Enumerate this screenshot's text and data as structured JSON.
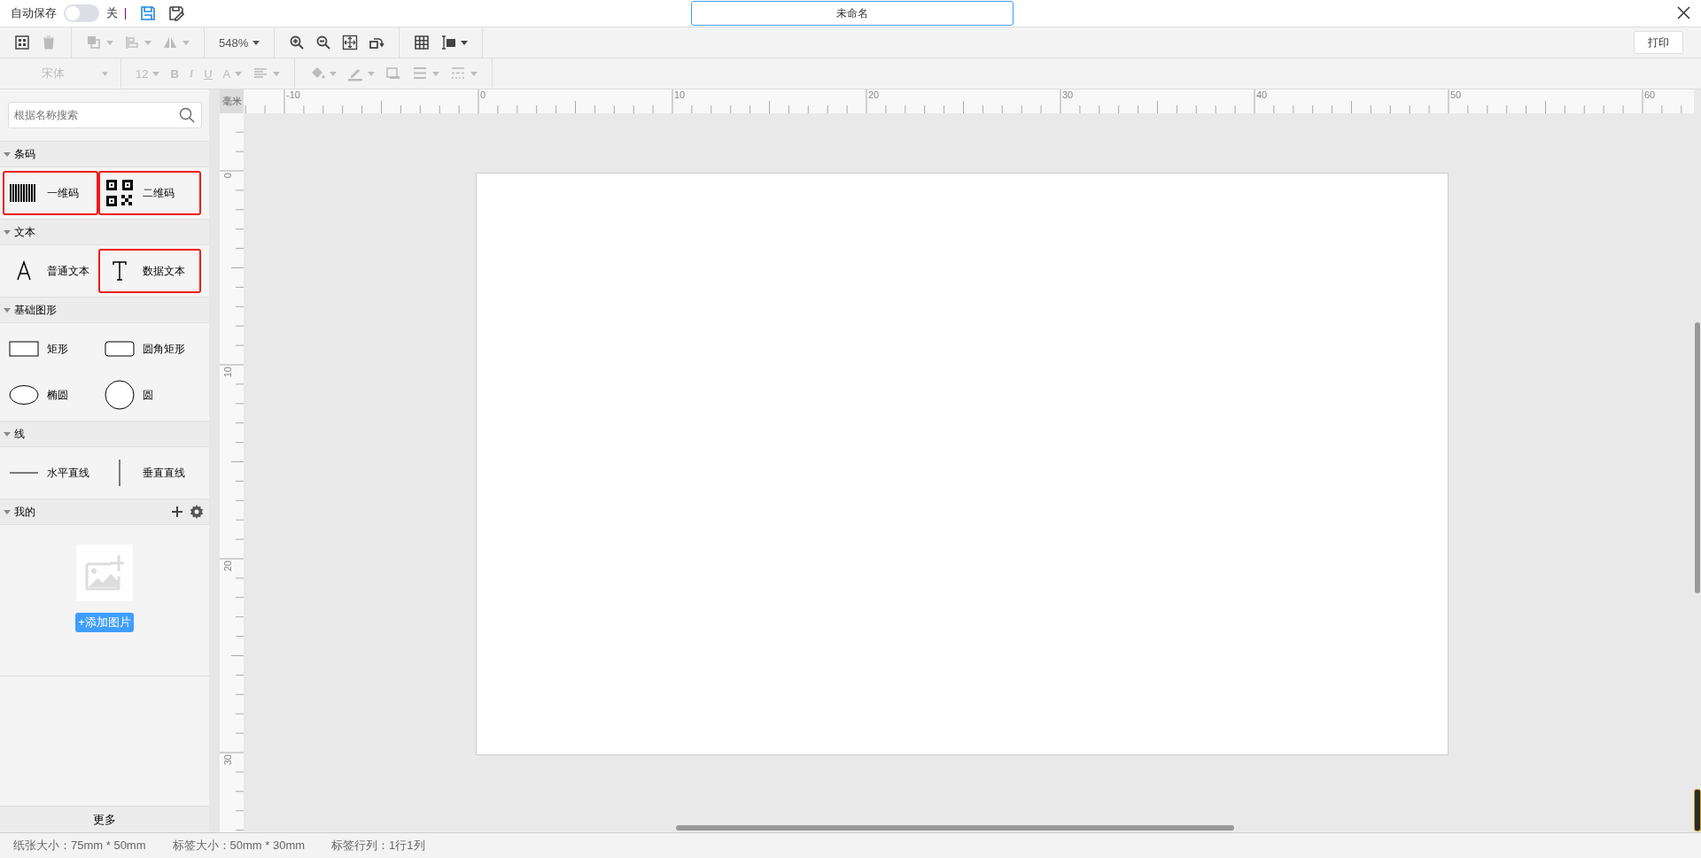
{
  "top_bar": {
    "autosave_label": "自动保存",
    "autosave_on": false,
    "autosave_state": "关",
    "document_title": "未命名"
  },
  "toolbar_rows": [
    [
      [
        {
          "kind": "select-all",
          "disabled": false,
          "dropdown": false
        },
        {
          "kind": "delete",
          "disabled": true,
          "dropdown": false
        }
      ],
      [
        {
          "kind": "layer",
          "disabled": true,
          "dropdown": true
        },
        {
          "kind": "align",
          "disabled": true,
          "dropdown": true
        },
        {
          "kind": "flip",
          "disabled": true,
          "dropdown": true
        }
      ],
      [
        {
          "kind": "zoom-level",
          "disabled": false,
          "dropdown": true,
          "label": "548%"
        }
      ],
      [
        {
          "kind": "zoom-in",
          "disabled": false,
          "dropdown": false
        },
        {
          "kind": "zoom-out",
          "disabled": false,
          "dropdown": false
        },
        {
          "kind": "fit",
          "disabled": false,
          "dropdown": false
        },
        {
          "kind": "rotate",
          "disabled": false,
          "dropdown": false
        }
      ],
      [
        {
          "kind": "grid",
          "disabled": false,
          "dropdown": false
        },
        {
          "kind": "ruler-unit",
          "disabled": false,
          "dropdown": true
        }
      ]
    ],
    [
      [
        {
          "kind": "font",
          "disabled": true,
          "dropdown": true,
          "label": "宋体"
        }
      ],
      [
        {
          "kind": "font-size",
          "disabled": true,
          "dropdown": true,
          "label": "12"
        },
        {
          "kind": "bold",
          "disabled": true,
          "dropdown": false,
          "label": "B"
        },
        {
          "kind": "italic",
          "disabled": true,
          "dropdown": false,
          "label": "I"
        },
        {
          "kind": "underline",
          "disabled": true,
          "dropdown": false,
          "label": "U"
        },
        {
          "kind": "font-color",
          "disabled": true,
          "dropdown": true,
          "label": "A"
        },
        {
          "kind": "text-align",
          "disabled": true,
          "dropdown": true
        }
      ],
      [
        {
          "kind": "fill",
          "disabled": true,
          "dropdown": true
        },
        {
          "kind": "line-color",
          "disabled": true,
          "dropdown": true
        },
        {
          "kind": "shadow",
          "disabled": true,
          "dropdown": false
        },
        {
          "kind": "line-width",
          "disabled": true,
          "dropdown": true
        },
        {
          "kind": "dash",
          "disabled": true,
          "dropdown": true
        }
      ]
    ]
  ],
  "print_button": "打印",
  "sidebar": {
    "search": {
      "placeholder": "根据名称搜索"
    },
    "sections": [
      {
        "kind": "components",
        "title": "条码",
        "expanded": true,
        "items": [
          {
            "label": "一维码",
            "kind": "barcode",
            "highlighted": true
          },
          {
            "label": "二维码",
            "kind": "qrcode",
            "highlighted": true
          }
        ]
      },
      {
        "kind": "components",
        "title": "文本",
        "expanded": true,
        "items": [
          {
            "label": "普通文本",
            "kind": "letter-a",
            "highlighted": false
          },
          {
            "label": "数据文本",
            "kind": "letter-t",
            "highlighted": true
          }
        ]
      },
      {
        "kind": "components",
        "title": "基础图形",
        "expanded": true,
        "items": [
          {
            "label": "矩形",
            "kind": "rect",
            "highlighted": false
          },
          {
            "label": "圆角矩形",
            "kind": "round-rect",
            "highlighted": false
          },
          {
            "label": "椭圆",
            "kind": "ellipse",
            "highlighted": false
          },
          {
            "label": "圆",
            "kind": "circle",
            "highlighted": false
          }
        ]
      },
      {
        "kind": "components",
        "title": "线",
        "expanded": true,
        "items": [
          {
            "label": "水平直线",
            "kind": "hline",
            "highlighted": false
          },
          {
            "label": "垂直直线",
            "kind": "vline",
            "highlighted": false
          }
        ]
      },
      {
        "kind": "library",
        "title": "我的",
        "expanded": true,
        "upload_button": "+添加图片"
      }
    ],
    "more_button": "更多"
  },
  "ruler": {
    "unit": "毫米",
    "top_labels": [
      "-10",
      "0",
      "10",
      "20",
      "30",
      "40",
      "50",
      "60"
    ],
    "left_labels": [
      "0",
      "10",
      "20",
      "30"
    ]
  },
  "status_bar": [
    "纸张大小：75mm * 50mm",
    "标签大小：50mm * 30mm",
    "标签行列：1行1列"
  ]
}
